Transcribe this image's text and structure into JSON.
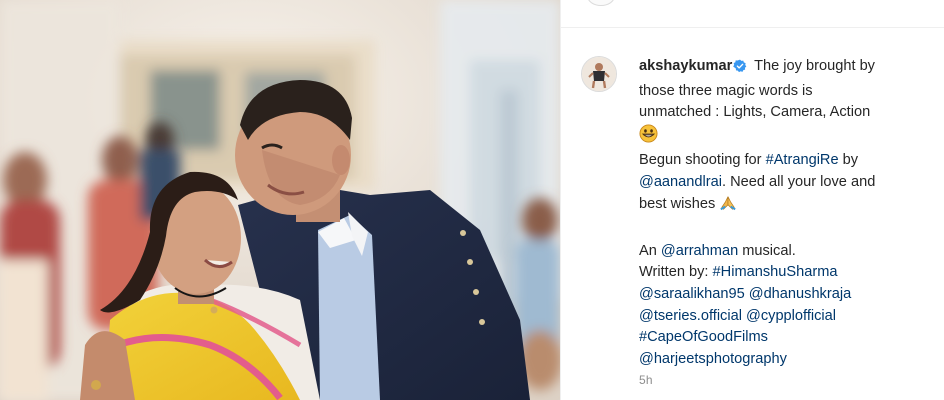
{
  "post": {
    "image_alt": "Akshay Kumar and Sara Ali Khan smiling at each other on a film set",
    "header": {
      "avatar_icon": "profile-avatar-icon"
    }
  },
  "comment": {
    "avatar_icon": "profile-avatar-icon",
    "verified_icon": "verified-badge-icon",
    "verified_color": "#3897f0",
    "username": "akshaykumar",
    "lines": {
      "l1_text": " The joy brought by",
      "l2_text": "those three magic words is",
      "l3_text": "unmatched : Lights, Camera, Action",
      "l5_prefix": "Begun shooting for ",
      "hashtag_atrangire": "#AtrangiRe",
      "l5_suffix": " by",
      "mention_aanandlrai": "@aanandlrai",
      "l6_suffix": ". Need all your love and",
      "l7_text": "best wishes ",
      "l9_prefix": "An ",
      "mention_arrahman": "@arrahman",
      "l9_suffix": " musical.",
      "l10_prefix": "Written by: ",
      "hashtag_himanshusharma": "#HimanshuSharma",
      "mention_saraalikhan95": "@saraalikhan95",
      "mention_dhanushkraja": "@dhanushkraja",
      "mention_tseriesofficial": "@tseries.official",
      "mention_cypplofficial": "@cypplofficial",
      "hashtag_capeofgoodfilms": "#CapeOfGoodFilms",
      "mention_harjeetsphotography": "@harjeetsphotography"
    },
    "emoji_icons": [
      "grinning-face-emoji",
      "folded-hands-emoji"
    ],
    "link_color": "#00376b",
    "timestamp": "5h"
  }
}
